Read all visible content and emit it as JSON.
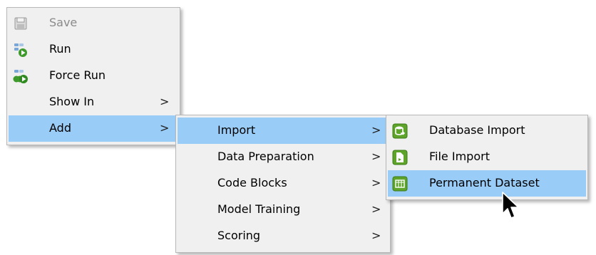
{
  "main_menu": [
    {
      "label": "Save",
      "icon": "save-icon",
      "enabled": false
    },
    {
      "label": "Run",
      "icon": "run-icon",
      "enabled": true
    },
    {
      "label": "Force Run",
      "icon": "force-run-icon",
      "enabled": true
    },
    {
      "label": "Show In",
      "submenu_arrow": ">",
      "enabled": true
    },
    {
      "label": "Add",
      "submenu_arrow": ">",
      "enabled": true,
      "highlighted": true
    }
  ],
  "add_menu": [
    {
      "label": "Import",
      "submenu_arrow": ">",
      "highlighted": true
    },
    {
      "label": "Data Preparation",
      "submenu_arrow": ">"
    },
    {
      "label": "Code Blocks",
      "submenu_arrow": ">"
    },
    {
      "label": "Model Training",
      "submenu_arrow": ">"
    },
    {
      "label": "Scoring",
      "submenu_arrow": ">"
    }
  ],
  "import_menu": [
    {
      "label": "Database Import",
      "icon": "database-import-icon"
    },
    {
      "label": "File Import",
      "icon": "file-import-icon"
    },
    {
      "label": "Permanent Dataset",
      "icon": "permanent-dataset-icon",
      "highlighted": true
    }
  ],
  "colors": {
    "menu_background": "#f0f0f0",
    "highlight": "#99ccf7",
    "disabled_text": "#8a8a8a",
    "icon_green": "#5ea42a"
  }
}
